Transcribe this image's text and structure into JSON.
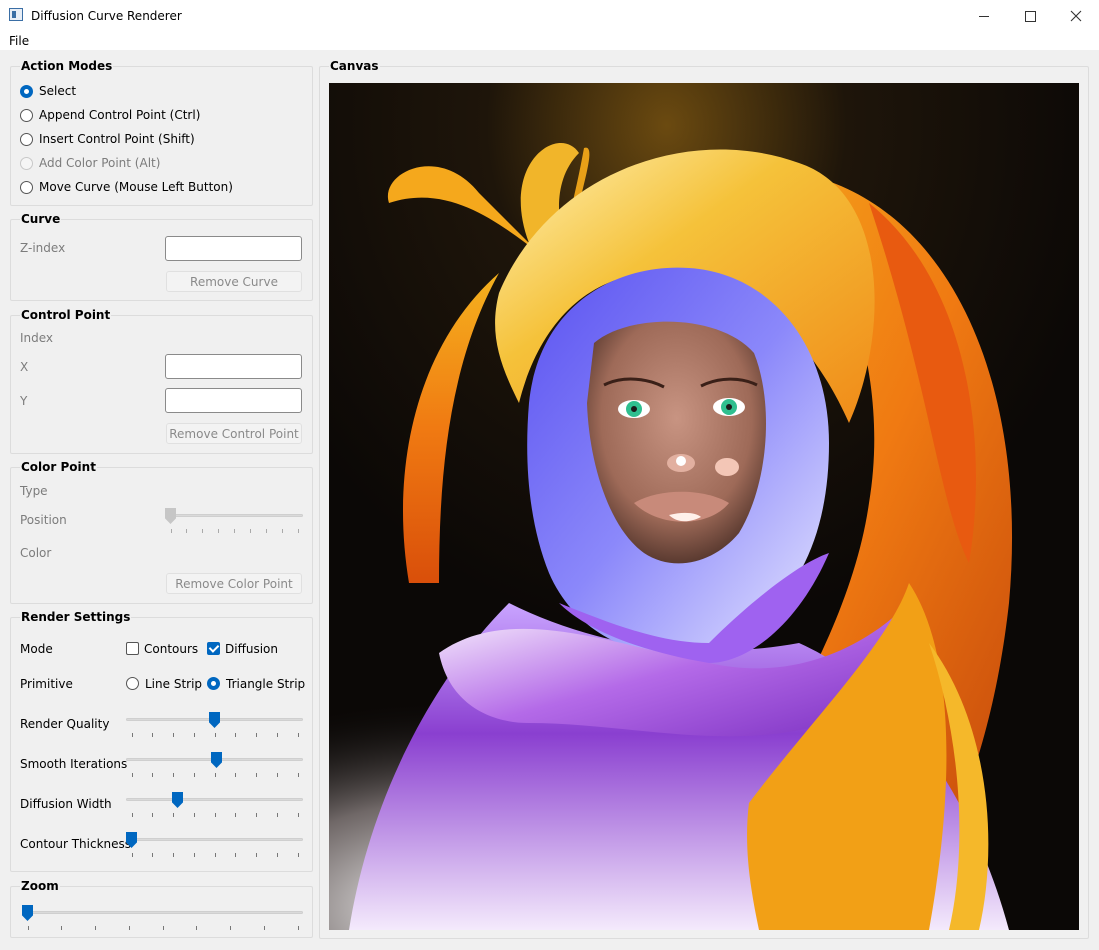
{
  "window": {
    "title": "Diffusion Curve Renderer"
  },
  "menu": {
    "file": "File"
  },
  "action_modes": {
    "title": "Action Modes",
    "options": [
      {
        "label": "Select",
        "selected": true,
        "enabled": true
      },
      {
        "label": "Append Control Point (Ctrl)",
        "selected": false,
        "enabled": true
      },
      {
        "label": "Insert Control Point (Shift)",
        "selected": false,
        "enabled": true
      },
      {
        "label": "Add Color Point (Alt)",
        "selected": false,
        "enabled": false
      },
      {
        "label": "Move Curve (Mouse Left Button)",
        "selected": false,
        "enabled": true
      }
    ]
  },
  "curve": {
    "title": "Curve",
    "z_index_label": "Z-index",
    "z_index_value": "",
    "remove_button": "Remove Curve"
  },
  "control_point": {
    "title": "Control Point",
    "index_label": "Index",
    "x_label": "X",
    "x_value": "",
    "y_label": "Y",
    "y_value": "",
    "remove_button": "Remove Control Point"
  },
  "color_point": {
    "title": "Color Point",
    "type_label": "Type",
    "position_label": "Position",
    "position_value": 0,
    "color_label": "Color",
    "remove_button": "Remove Color Point"
  },
  "render_settings": {
    "title": "Render Settings",
    "mode_label": "Mode",
    "contours_label": "Contours",
    "contours_checked": false,
    "diffusion_label": "Diffusion",
    "diffusion_checked": true,
    "primitive_label": "Primitive",
    "line_strip_label": "Line Strip",
    "line_strip_selected": false,
    "triangle_strip_label": "Triangle Strip",
    "triangle_strip_selected": true,
    "sliders": [
      {
        "label": "Render Quality",
        "value": 0.5
      },
      {
        "label": "Smooth Iterations",
        "value": 0.51
      },
      {
        "label": "Diffusion Width",
        "value": 0.28
      },
      {
        "label": "Contour Thickness",
        "value": 0.0
      }
    ]
  },
  "zoom": {
    "title": "Zoom",
    "value": 0.0
  },
  "canvas": {
    "title": "Canvas"
  },
  "colors": {
    "accent": "#0067c0",
    "purple": "#8a3fd0",
    "violet_hood": "#6f6cf2",
    "orange": "#f07a12",
    "yellow": "#f5c23a",
    "skin": "#b07a66",
    "background": "#0e0b08"
  }
}
